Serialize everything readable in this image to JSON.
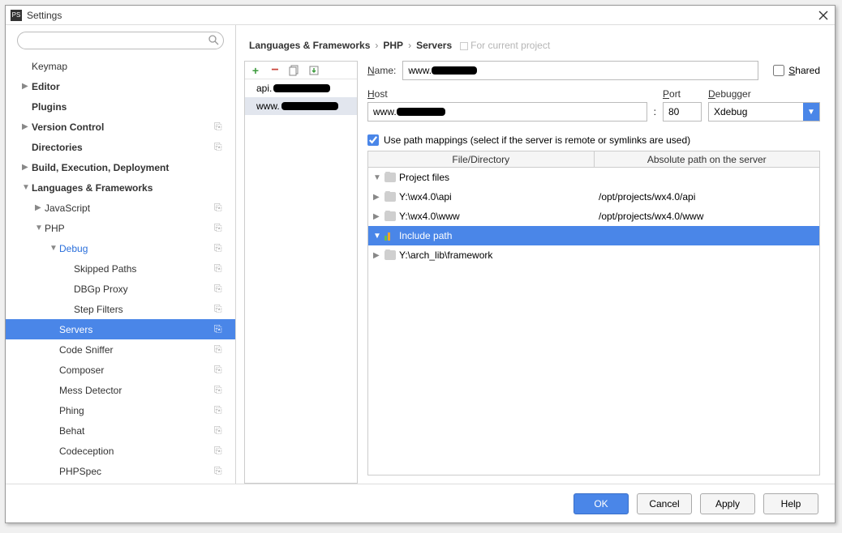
{
  "window": {
    "title": "Settings"
  },
  "sidebar": {
    "search_placeholder": "",
    "items": [
      {
        "label": "Keymap",
        "bold": false,
        "indent": 0,
        "arrow": "",
        "badge": ""
      },
      {
        "label": "Editor",
        "bold": true,
        "indent": 0,
        "arrow": "▶",
        "badge": ""
      },
      {
        "label": "Plugins",
        "bold": true,
        "indent": 0,
        "arrow": "",
        "badge": ""
      },
      {
        "label": "Version Control",
        "bold": true,
        "indent": 0,
        "arrow": "▶",
        "badge": "⎘"
      },
      {
        "label": "Directories",
        "bold": true,
        "indent": 0,
        "arrow": "",
        "badge": "⎘"
      },
      {
        "label": "Build, Execution, Deployment",
        "bold": true,
        "indent": 0,
        "arrow": "▶",
        "badge": ""
      },
      {
        "label": "Languages & Frameworks",
        "bold": true,
        "indent": 0,
        "arrow": "▼",
        "badge": ""
      },
      {
        "label": "JavaScript",
        "bold": false,
        "indent": 1,
        "arrow": "▶",
        "badge": "⎘"
      },
      {
        "label": "PHP",
        "bold": false,
        "indent": 1,
        "arrow": "▼",
        "badge": "⎘"
      },
      {
        "label": "Debug",
        "bold": false,
        "indent": 2,
        "arrow": "▼",
        "badge": "⎘",
        "link": true
      },
      {
        "label": "Skipped Paths",
        "bold": false,
        "indent": 3,
        "arrow": "",
        "badge": "⎘"
      },
      {
        "label": "DBGp Proxy",
        "bold": false,
        "indent": 3,
        "arrow": "",
        "badge": "⎘"
      },
      {
        "label": "Step Filters",
        "bold": false,
        "indent": 3,
        "arrow": "",
        "badge": "⎘"
      },
      {
        "label": "Servers",
        "bold": false,
        "indent": 2,
        "arrow": "",
        "badge": "⎘",
        "selected": true
      },
      {
        "label": "Code Sniffer",
        "bold": false,
        "indent": 2,
        "arrow": "",
        "badge": "⎘"
      },
      {
        "label": "Composer",
        "bold": false,
        "indent": 2,
        "arrow": "",
        "badge": "⎘"
      },
      {
        "label": "Mess Detector",
        "bold": false,
        "indent": 2,
        "arrow": "",
        "badge": "⎘"
      },
      {
        "label": "Phing",
        "bold": false,
        "indent": 2,
        "arrow": "",
        "badge": "⎘"
      },
      {
        "label": "Behat",
        "bold": false,
        "indent": 2,
        "arrow": "",
        "badge": "⎘"
      },
      {
        "label": "Codeception",
        "bold": false,
        "indent": 2,
        "arrow": "",
        "badge": "⎘"
      },
      {
        "label": "PHPSpec",
        "bold": false,
        "indent": 2,
        "arrow": "",
        "badge": "⎘"
      }
    ]
  },
  "breadcrumbs": {
    "parts": [
      "Languages & Frameworks",
      "PHP",
      "Servers"
    ],
    "tag": "For current project"
  },
  "server_list": {
    "items": [
      {
        "prefix": "api.",
        "selected": false
      },
      {
        "prefix": "www.",
        "selected": true
      }
    ]
  },
  "form": {
    "name_label": "Name:",
    "name_value_prefix": "www.",
    "shared_label": "Shared",
    "host_label": "Host",
    "host_value_prefix": "www.",
    "port_label": "Port",
    "port_value": "80",
    "debugger_label": "Debugger",
    "debugger_value": "Xdebug",
    "colon": ":",
    "mappings_label": "Use path mappings (select if the server is remote or symlinks are used)"
  },
  "map_table": {
    "head_left": "File/Directory",
    "head_right": "Absolute path on the server",
    "rows": [
      {
        "type": "group",
        "arrow": "▼",
        "label": "Project files",
        "right": "",
        "pad": 0
      },
      {
        "type": "item",
        "arrow": "▶",
        "label": "Y:\\wx4.0\\api",
        "right": "/opt/projects/wx4.0/api",
        "pad": 1
      },
      {
        "type": "item",
        "arrow": "▶",
        "label": "Y:\\wx4.0\\www",
        "right": "/opt/projects/wx4.0/www",
        "pad": 1
      },
      {
        "type": "group-sel",
        "arrow": "▼",
        "label": "Include path",
        "right": "",
        "pad": 0
      },
      {
        "type": "item",
        "arrow": "▶",
        "label": "Y:\\arch_lib\\framework",
        "right": "",
        "pad": 1
      }
    ]
  },
  "footer": {
    "ok": "OK",
    "cancel": "Cancel",
    "apply": "Apply",
    "help": "Help"
  }
}
